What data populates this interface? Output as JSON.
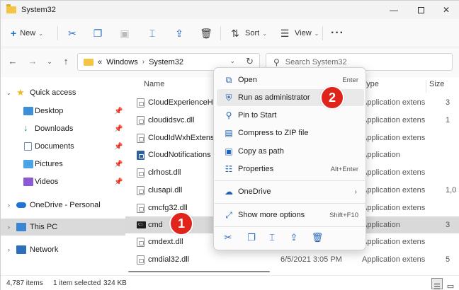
{
  "window": {
    "title": "System32",
    "minimize_glyph": "—",
    "close_glyph": "✕"
  },
  "toolbar": {
    "new_label": "New",
    "sort_label": "Sort",
    "view_label": "View",
    "more_glyph": "···"
  },
  "address": {
    "overflow": "«",
    "crumbs": [
      "Windows",
      "System32"
    ],
    "separator": "›"
  },
  "search": {
    "placeholder": "Search System32"
  },
  "nav": {
    "items": [
      {
        "label": "Quick access",
        "icon": "star-icon"
      },
      {
        "label": "Desktop",
        "icon": "desktop-icon"
      },
      {
        "label": "Downloads",
        "icon": "downloads-icon"
      },
      {
        "label": "Documents",
        "icon": "documents-icon"
      },
      {
        "label": "Pictures",
        "icon": "pictures-icon"
      },
      {
        "label": "Videos",
        "icon": "videos-icon"
      },
      {
        "label": "OneDrive - Personal",
        "icon": "onedrive-icon"
      },
      {
        "label": "This PC",
        "icon": "this-pc-icon"
      },
      {
        "label": "Network",
        "icon": "network-icon"
      }
    ]
  },
  "files": {
    "columns": {
      "name": "Name",
      "type": "Type",
      "size": "Size"
    },
    "rows": [
      {
        "name": "CloudExperienceHostUser.dll",
        "date": "",
        "type": "Application extens",
        "size": "3"
      },
      {
        "name": "cloudidsvc.dll",
        "date": "",
        "type": "Application extens",
        "size": "1"
      },
      {
        "name": "CloudIdWxhExtension.dll",
        "date": "",
        "type": "Application extens",
        "size": ""
      },
      {
        "name": "CloudNotifications",
        "date": "",
        "type": "Application",
        "size": ""
      },
      {
        "name": "clrhost.dll",
        "date": "",
        "type": "Application extens",
        "size": ""
      },
      {
        "name": "clusapi.dll",
        "date": "",
        "type": "Application extens",
        "size": "1,0"
      },
      {
        "name": "cmcfg32.dll",
        "date": "",
        "type": "Application extens",
        "size": ""
      },
      {
        "name": "cmd",
        "date": "",
        "type": "Application",
        "size": "3"
      },
      {
        "name": "cmdext.dll",
        "date": "",
        "type": "Application extens",
        "size": ""
      },
      {
        "name": "cmdial32.dll",
        "date": "6/5/2021 3:05 PM",
        "type": "Application extens",
        "size": "5"
      }
    ]
  },
  "context_menu": {
    "items": [
      {
        "label": "Open",
        "shortcut": "Enter",
        "icon": "open-icon"
      },
      {
        "label": "Run as administrator",
        "shortcut": "",
        "icon": "shield-icon"
      },
      {
        "label": "Pin to Start",
        "shortcut": "",
        "icon": "pin-icon"
      },
      {
        "label": "Compress to ZIP file",
        "shortcut": "",
        "icon": "zip-icon"
      },
      {
        "label": "Copy as path",
        "shortcut": "",
        "icon": "copy-path-icon"
      },
      {
        "label": "Properties",
        "shortcut": "Alt+Enter",
        "icon": "properties-icon"
      },
      {
        "label": "OneDrive",
        "shortcut": "",
        "icon": "onedrive-icon"
      },
      {
        "label": "Show more options",
        "shortcut": "Shift+F10",
        "icon": "more-options-icon"
      }
    ],
    "quick_actions": [
      "cut-icon",
      "copy-icon",
      "rename-icon",
      "share-icon",
      "delete-icon"
    ]
  },
  "status": {
    "items_count": "4,787 items",
    "selection": "1 item selected",
    "size": "324 KB"
  },
  "badges": [
    "1",
    "2"
  ],
  "colors": {
    "badge": "#e0241b",
    "accent": "#1f62b6",
    "selection": "#d9d9d9"
  }
}
